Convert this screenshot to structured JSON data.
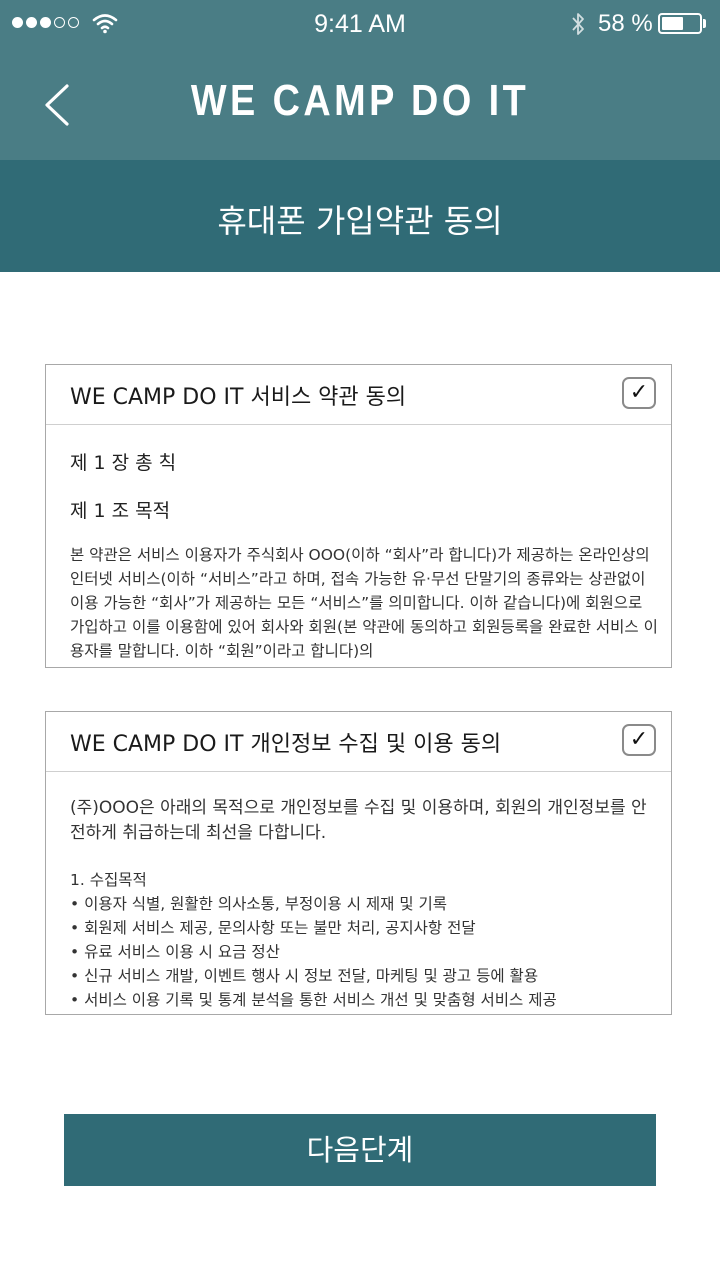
{
  "status_bar": {
    "time": "9:41 AM",
    "battery_text": "58 %",
    "battery_level": 0.58,
    "signal_bars_filled": 3,
    "signal_bars_total": 5,
    "icons": [
      "signal-dots-icon",
      "wifi-icon",
      "bluetooth-icon",
      "battery-icon"
    ]
  },
  "header": {
    "app_title": "WE CAMP DO IT",
    "back_icon": "chevron-left-icon",
    "sub_title": "휴대폰 가입약관 동의"
  },
  "terms_service": {
    "title": "WE CAMP DO IT 서비스 약관 동의",
    "checked": true,
    "check_mark": "✓",
    "chapter": "제 1 장 총 칙",
    "article": "제 1 조 목적",
    "text": "본 약관은 서비스 이용자가 주식회사 OOO(이하 “회사”라 합니다)가 제공하는 온라인상의 인터넷 서비스(이하 “서비스”라고 하며, 접속 가능한 유·무선 단말기의 종류와는 상관없이 이용 가능한 “회사”가 제공하는 모든 “서비스”를 의미합니다. 이하 같습니다)에 회원으로 가입하고 이를 이용함에 있어 회사와 회원(본 약관에 동의하고 회원등록을 완료한 서비스 이용자를 말합니다. 이하 “회원”이라고 합니다)의"
  },
  "terms_privacy": {
    "title": "WE CAMP DO IT 개인정보 수집 및 이용 동의",
    "checked": true,
    "check_mark": "✓",
    "intro": "(주)OOO은 아래의 목적으로 개인정보를 수집 및 이용하며, 회원의 개인정보를 안전하게 취급하는데 최선을 다합니다.",
    "purpose_title": "1. 수집목적",
    "purposes": [
      "이용자 식별, 원활한 의사소통, 부정이용 시 제재 및 기록",
      "회원제 서비스 제공, 문의사항 또는 불만 처리, 공지사항 전달",
      "유료 서비스 이용 시 요금 정산",
      "신규 서비스 개발, 이벤트 행사 시 정보 전달, 마케팅 및 광고 등에 활용",
      "서비스 이용 기록 및 통계 분석을 통한 서비스 개선 및 맞춤형 서비스 제공"
    ]
  },
  "next_button": {
    "label": "다음단계"
  },
  "colors": {
    "app_bar": "#4a7d85",
    "sub_bar": "#306b76",
    "button": "#306b76",
    "border": "#a8a8a8"
  }
}
